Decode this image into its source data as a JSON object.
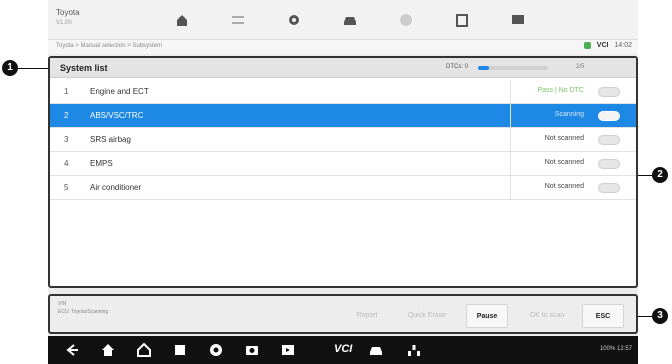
{
  "app": {
    "make": "Toyota",
    "make_sub": "V1.00"
  },
  "breadcrumb": "Toyota > Manual selection > Subsystem",
  "status": {
    "vci_label": "VCI",
    "time": "14:02"
  },
  "callouts": [
    "1",
    "2",
    "3"
  ],
  "system_list": {
    "title": "System list",
    "dtc_label": "DTCs: 0",
    "progress": 0.15,
    "progress_text": "2/5",
    "rows": [
      {
        "num": "1",
        "name": "Engine and ECT",
        "status": "Pass | No DTC",
        "state": "passed"
      },
      {
        "num": "2",
        "name": "ABS/VSC/TRC",
        "status": "Scanning",
        "state": "selected"
      },
      {
        "num": "3",
        "name": "SRS airbag",
        "status": "Not scanned",
        "state": "normal"
      },
      {
        "num": "4",
        "name": "EMPS",
        "status": "Not scanned",
        "state": "normal"
      },
      {
        "num": "5",
        "name": "Air conditioner",
        "status": "Not scanned",
        "state": "normal"
      }
    ]
  },
  "function_bar": {
    "info_line1": "VIN",
    "info_line2": "ECU: Toyota/Scanning",
    "buttons": [
      {
        "label": "Report",
        "active": false
      },
      {
        "label": "Quick Erase",
        "active": false
      },
      {
        "label": "Pause",
        "active": true
      },
      {
        "label": "OK to scan",
        "active": false
      },
      {
        "label": "ESC",
        "active": true
      }
    ]
  },
  "navbar": {
    "vci_label": "VCI",
    "system_status": "100% 12:57"
  },
  "colors": {
    "accent": "#1e88e5",
    "passed": "#7cc36a",
    "navbar": "#111111"
  }
}
